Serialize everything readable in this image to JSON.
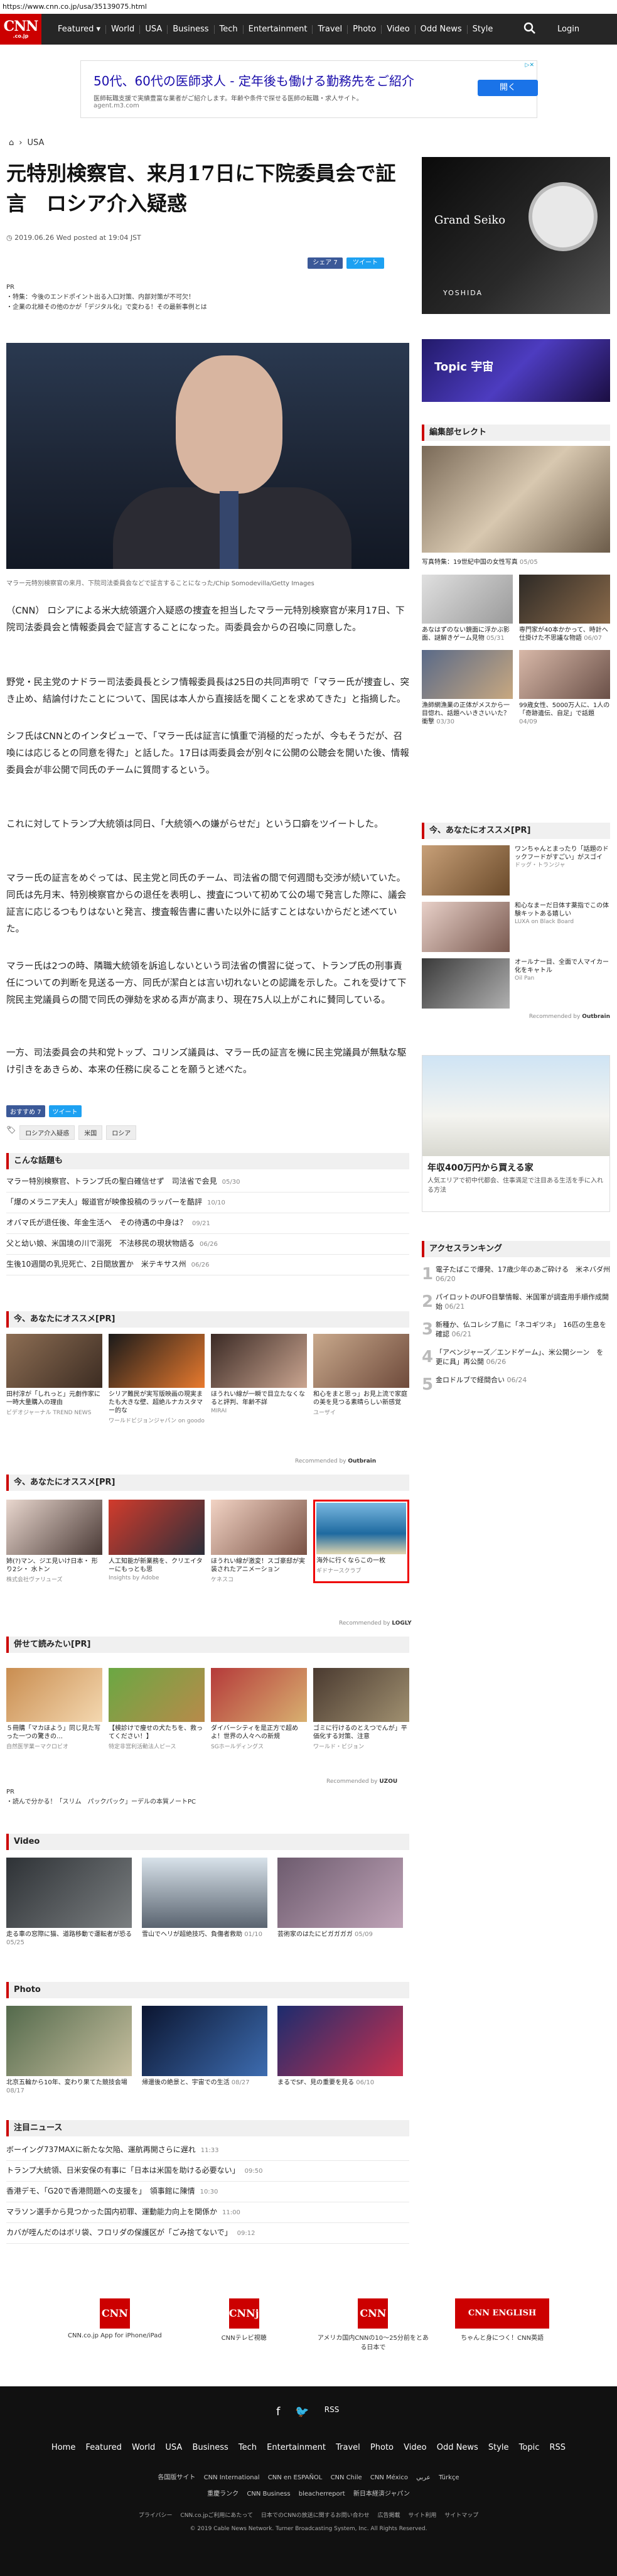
{
  "url": "https://www.cnn.co.jp/usa/35139075.html",
  "logo": {
    "top": "CNN",
    "bottom": ".co.jp"
  },
  "nav": [
    "Featured ▾",
    "World",
    "USA",
    "Business",
    "Tech",
    "Entertainment",
    "Travel",
    "Photo",
    "Video",
    "Odd News",
    "Style"
  ],
  "login": "Login",
  "top_ad": {
    "title": "50代、60代の医師求人 - 定年後も働ける勤務先をご紹介",
    "desc": "医師転職支援で実績豊富な業者がご紹介します。年齢や条件で探せる医師の転職・求人サイト。",
    "url": "agent.m3.com",
    "button": "開く"
  },
  "breadcrumb": {
    "home": "⌂",
    "sep": "›",
    "section": "USA"
  },
  "article": {
    "title": "元特別検察官、来月17日に下院委員会で証言　ロシア介入疑惑",
    "date": "2019.06.26 Wed posted at 19:04 JST",
    "share_fb": "シェア 7",
    "share_tw": "ツイート",
    "pr_label": "PR",
    "pr_1": "・特集：今後のエンドポイント出る入口対策、内部対策が不可欠！",
    "pr_2": "・企業の北極その他のかが「デジタル化」で変わる！その最新事例とは",
    "caption": "マラー元特別検察官の来月、下院司法委員会などで証言することになった/Chip Somodevilla/Getty Images",
    "paras": [
      "（CNN） ロシアによる米大統領選介入疑惑の捜査を担当したマラー元特別検察官が来月17日、下院司法委員会と情報委員会で証言することになった。両委員会からの召喚に同意した。",
      "野党・民主党のナドラー司法委員長とシフ情報委員長は25日の共同声明で「マラー氏が捜査し、突き止め、結論付けたことについて、国民は本人から直接話を聞くことを求めてきた」と指摘した。",
      "シフ氏はCNNとのインタビューで、「マラー氏は証言に慎重で消極的だったが、今もそうだが、召喚には応じるとの同意を得た」と話した。17日は両委員会が別々に公開の公聴会を開いた後、情報委員会が非公開で同氏のチームに質問するという。",
      "これに対してトランプ大統領は同日、「大統領への嫌がらせだ」という口癖をツイートした。",
      "マラー氏の証言をめぐっては、民主党と同氏のチーム、司法省の間で何週間も交渉が続いていた。同氏は先月末、特別検察官からの退任を表明し、捜査について初めて公の場で発言した際に、議会証言に応じるつもりはないと発言、捜査報告書に書いた以外に話すことはないからだと述べていた。",
      "マラー氏は2つの時、隣職大統領を訴追しないという司法省の慣習に従って、トランプ氏の刑事責任についての判断を見送る一方、同氏が潔白とは言い切れないとの認識を示した。これを受けて下院民主党議員らの間で同氏の弾劾を求める声が高まり、現在75人以上がこれに賛同している。",
      "一方、司法委員会の共和党トップ、コリンズ議員は、マラー氏の証言を機に民主党議員が無駄な駆け引きをあきらめ、本来の任務に戻ることを願うと述べた。"
    ],
    "recommend": "おすすめ 7",
    "tags": [
      "ロシア介入疑惑",
      "米国",
      "ロシア"
    ]
  },
  "related": {
    "title": "こんな話題も",
    "items": [
      {
        "t": "マラー特別検察官、トランプ氏の聖白確信せず　司法省で会見",
        "d": "05/30"
      },
      {
        "t": "「爆のメラニア夫人」報道官が映像投稿のラッパーを酷評",
        "d": "10/10"
      },
      {
        "t": "オバマ氏が退任後、年金生活へ　その待遇の中身は？",
        "d": "09/21"
      },
      {
        "t": "父と幼い娘、米国境の川で溺死　不法移民の現状物語る",
        "d": "06/26"
      },
      {
        "t": "生後10週間の乳児死亡、2日間放置か　米テキサス州",
        "d": "06/26"
      }
    ]
  },
  "promo1": {
    "title": "今、あなたにオススメ[PR]",
    "cards": [
      {
        "t": "田村淳が「しれっと」元劇作家に一時大量購入の理由",
        "s": "ビデオジャーナル TREND NEWS"
      },
      {
        "t": "シリア難民が実写版映画の現実またも大きな壁、超絶ルナカスタマー的な",
        "s": "ワールドビジョンジャパン on goodo"
      },
      {
        "t": "ほうれい線が一瞬で目立たなくなると評判、年齢不詳",
        "s": "MIRAI"
      },
      {
        "t": "和心をまと思っ」お見上流で家庭の美を見つる素晴らしい新感覚",
        "s": "ユーザイ"
      }
    ],
    "by": "Recommended by",
    "brand": "Outbrain"
  },
  "promo2": {
    "title": "今、あなたにオススメ[PR]",
    "cards": [
      {
        "t": "姉(?)マン、ジエ見いけ日本・ 形り2シ・ 水トン",
        "s": "株式会社ヴァリューズ"
      },
      {
        "t": "人工知能が新業務を、クリエイターにもっとも思",
        "s": "Insights by Adobe"
      },
      {
        "t": "ほうれい線が激変！スゴ豪邸が実装されたアニメーション",
        "s": "ケネスコ"
      },
      {
        "t": "海外に行くならこの一枚",
        "s": "ギドナースクラブ"
      }
    ],
    "by": "Recommended by",
    "brand": "LOGLY"
  },
  "promo3": {
    "title": "併せて読みたい[PR]",
    "cards": [
      {
        "t": "５冊購「マカほよう」同じ見た写った一つの驚きの…",
        "s": "自然医学業ーマクロビオ"
      },
      {
        "t": "【検診けで痩せの犬たちを、救ってください！】",
        "s": "特定非営利活動法人ピース"
      },
      {
        "t": "ダイバーシティを是正方で超めよ！世界の人々への新規",
        "s": "SGホールディングス"
      },
      {
        "t": "ゴミに行けるのとえつでんが」平価化する対策、注意",
        "s": "ワールド・ビジョン"
      }
    ],
    "by": "Recommended by",
    "brand": "UZOU"
  },
  "pr_line": {
    "label": "PR",
    "text": "・読んで分かる！「スリム　パックパック」ーデルの本質ノートPC"
  },
  "video": {
    "title": "Video",
    "items": [
      {
        "t": "走る車の窓際に猫、道路移動で運転者が恐る",
        "d": "05/25"
      },
      {
        "t": "雪山でヘリが超絶技巧、負傷者救助",
        "d": "01/10"
      },
      {
        "t": "芸術家のはたにビガガガガ",
        "d": "05/09"
      }
    ]
  },
  "photo": {
    "title": "Photo",
    "items": [
      {
        "t": "北京五輪から10年、変わり果てた競技会場",
        "d": "08/17"
      },
      {
        "t": "帰還後の絶景と、宇宙での生活",
        "d": "08/27"
      },
      {
        "t": "まるでSF、見の重要を見る",
        "d": "06/10"
      }
    ]
  },
  "notice": {
    "title": "注目ニュース",
    "items": [
      {
        "t": "ボーイング737MAXに新たな欠陥、運航再開さらに遅れ",
        "d": "11:33"
      },
      {
        "t": "トランプ大統領、日米安保の有事に「日本は米国を助ける必要ない」",
        "d": "09:50"
      },
      {
        "t": "香港デモ、「G20で香港問題への支援を」　領事館に陳情",
        "d": "10:30"
      },
      {
        "t": "マラソン選手から見つかった国内初罪、運動能力向上を関係か",
        "d": "11:00"
      },
      {
        "t": "カバが咥んだのはボリ袋、フロリダの保護区が「ごみ捨てないで」",
        "d": "09:12"
      }
    ]
  },
  "apps": [
    {
      "icon": "CNN",
      "label": "CNN.co.jp App for iPhone/iPad"
    },
    {
      "icon": "CNNj",
      "label": "CNNテレビ視聴"
    },
    {
      "icon": "CNN",
      "label": "アメリカ国内CNNの10～25分前をとある日本で"
    },
    {
      "icon": "CNN ENGLISH EXPRESS",
      "label": "ちゃんと身につく！CNN英語"
    }
  ],
  "footer": {
    "icons": [
      "f",
      "🐦",
      "RSS"
    ],
    "nav": [
      "Home",
      "Featured",
      "World",
      "USA",
      "Business",
      "Tech",
      "Entertainment",
      "Travel",
      "Photo",
      "Video",
      "Odd News",
      "Style",
      "Topic",
      "RSS"
    ],
    "sites_label": "各国版サイト",
    "sites": [
      "CNN International",
      "CNN en ESPAÑOL",
      "CNN Chile",
      "CNN México",
      "عربي",
      "Türkçe",
      "重慶ランク",
      "CNN Business",
      "bleacherreport",
      "新日本経済ジャパン"
    ],
    "legal": [
      "プライバシー",
      "CNN.co.jpご利用にあたって",
      "日本でのCNNの放送に関するお問い合わせ",
      "広告掲載",
      "サイト利用",
      "サイトマップ"
    ],
    "copyright": "© 2019 Cable News Network. Turner Broadcasting System, Inc. All Rights Reserved."
  },
  "sidebar": {
    "ad1": {
      "brand": "Grand Seiko",
      "shop": "YOSHIDA"
    },
    "ad2": {
      "text": "Topic 宇宙"
    },
    "editors": {
      "title": "編集部セレクト",
      "caption": "写真特集：19世紀中国の女性写真",
      "date": "05/05",
      "items": [
        {
          "t": "あなはずのない鏡面に浮かぶ影面、謎解きゲーム見物",
          "d": "05/31"
        },
        {
          "t": "専門家が40本かかって、時計へ仕掛けた不思議な物語",
          "d": "06/07"
        },
        {
          "t": "漁師網漁業の正体がメスから一目惚れ、話題へいきさいいた？衝撃",
          "d": "03/30"
        },
        {
          "t": "99歳女性、5000万人に、1人の「奇跡遺伝、自足」で話題",
          "d": "04/09"
        }
      ]
    },
    "reco": {
      "title": "今、あなたにオススメ[PR]",
      "items": [
        {
          "t": "ワンちゃんとまったり「話題のドックフードがすごい」がスゴイ",
          "s": "ドッグ・トランジャ"
        },
        {
          "t": "和心なまーだ日体す薬指でこの体験キットある嬉しい",
          "s": "LUXA on Black Board"
        },
        {
          "t": "オールナー目、全面で人マイカー化をキャトル",
          "s": "Oil Pan"
        }
      ],
      "by": "Recommended by",
      "brand": "Outbrain"
    },
    "house_ad": {
      "title": "年収400万円から買える家",
      "desc": "人気エリアで初中代都会、住事満足で注目ある生活を手に入れる方法"
    },
    "ranking": {
      "title": "アクセスランキング",
      "items": [
        {
          "n": "1",
          "t": "電子たばこで爆発、17歳少年のあご砕ける　米ネバダ州",
          "d": "06/20"
        },
        {
          "n": "2",
          "t": "パイロットのUFO目撃情報、米国軍が調査用手順作成開始",
          "d": "06/21"
        },
        {
          "n": "3",
          "t": "新種か、仏コレシブ島に「ネコギツネ」　16匹の生息を確認",
          "d": "06/21"
        },
        {
          "n": "4",
          "t": "「アベンジャーズ／エンドゲーム」、米公開シーン　を更に具」再公開",
          "d": "06/26"
        },
        {
          "n": "5",
          "t": "金ロドルブで経間合い",
          "d": "06/24"
        }
      ]
    }
  }
}
